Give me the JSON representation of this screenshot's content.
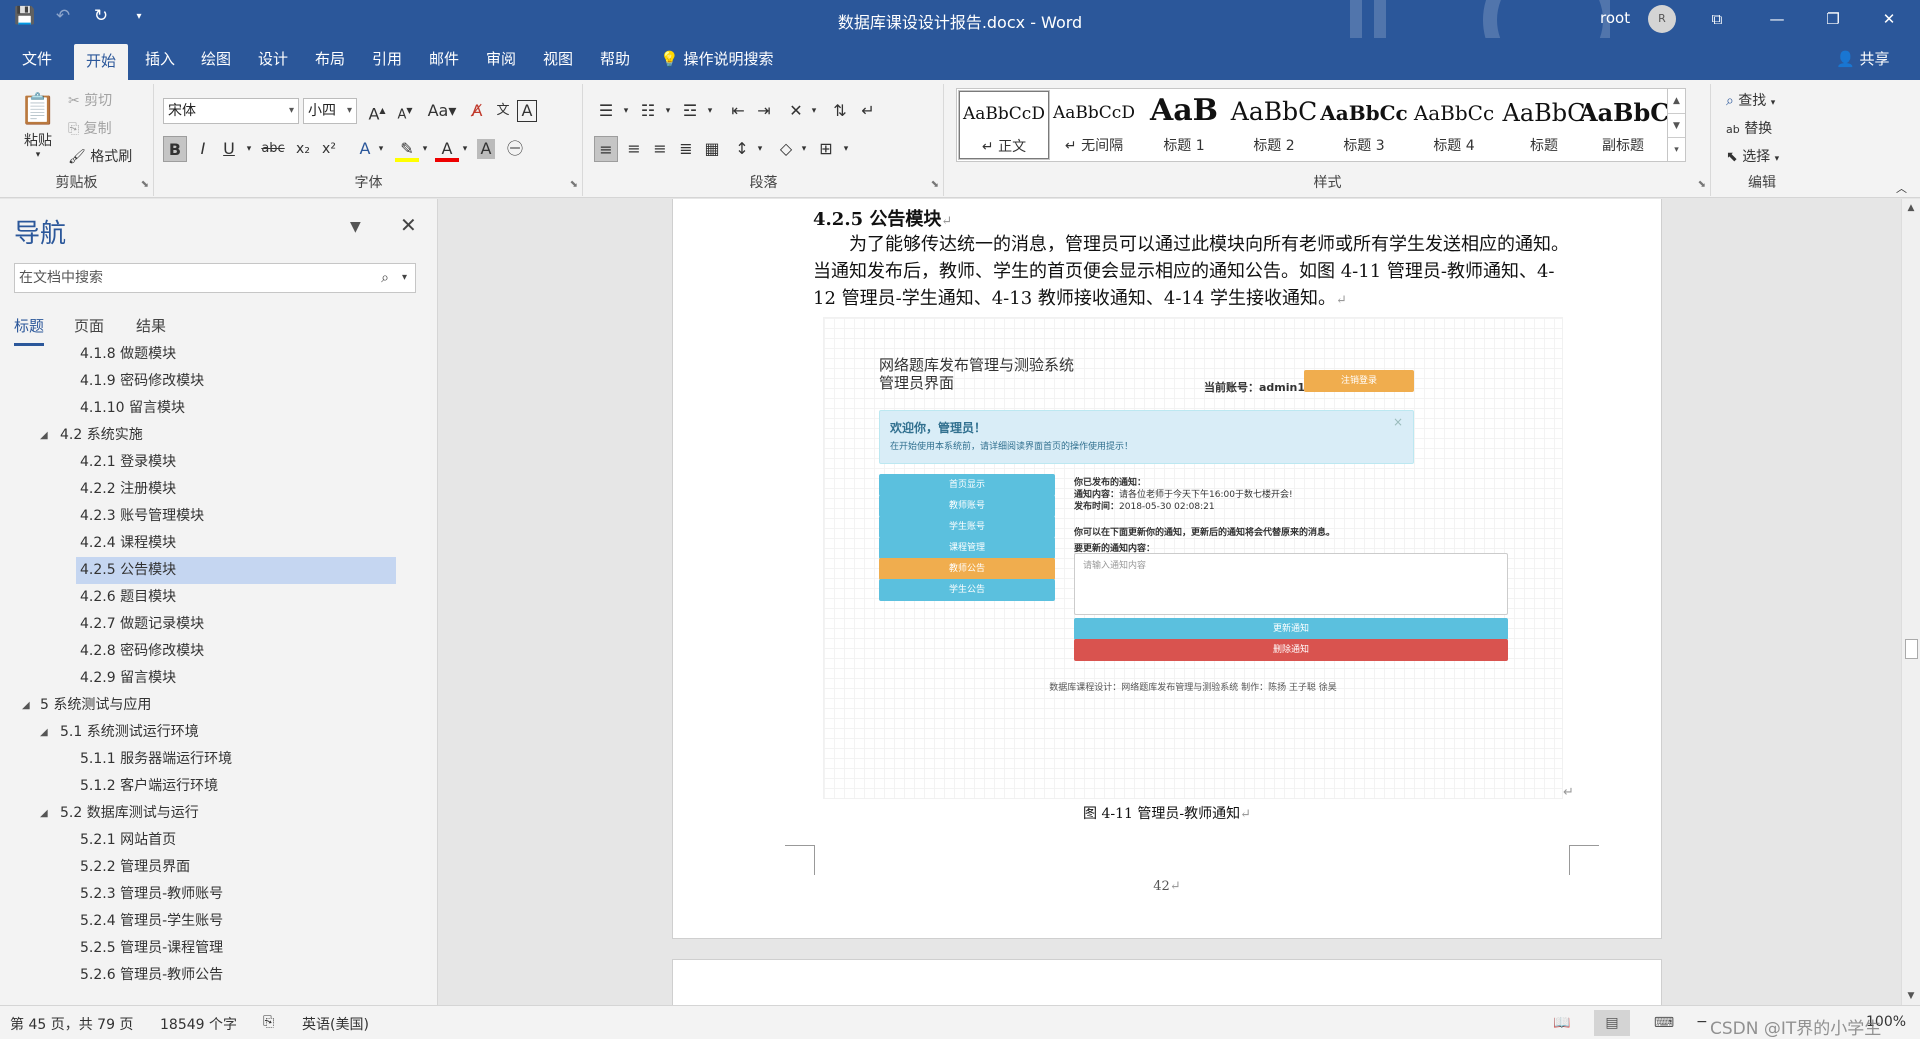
{
  "window": {
    "title": "数据库课设设计报告.docx - Word",
    "user": "root",
    "avatar_initial": "R"
  },
  "quick_access": [
    "save-icon",
    "undo-icon",
    "redo-icon",
    "customize-icon"
  ],
  "tabs": [
    {
      "label": "文件"
    },
    {
      "label": "开始"
    },
    {
      "label": "插入"
    },
    {
      "label": "绘图"
    },
    {
      "label": "设计"
    },
    {
      "label": "布局"
    },
    {
      "label": "引用"
    },
    {
      "label": "邮件"
    },
    {
      "label": "审阅"
    },
    {
      "label": "视图"
    },
    {
      "label": "帮助"
    }
  ],
  "tell_me": "操作说明搜索",
  "share": "共享",
  "clipboard": {
    "paste": "粘贴",
    "cut": "剪切",
    "copy": "复制",
    "format_painter": "格式刷",
    "label": "剪贴板"
  },
  "font": {
    "name": "宋体",
    "size": "小四",
    "label": "字体"
  },
  "paragraph": {
    "label": "段落"
  },
  "styles": {
    "label": "样式",
    "items": [
      {
        "preview": "AaBbCcD",
        "name": "↵ 正文"
      },
      {
        "preview": "AaBbCcD",
        "name": "↵ 无间隔"
      },
      {
        "preview": "AaB",
        "name": "标题 1"
      },
      {
        "preview": "AaBbC",
        "name": "标题 2"
      },
      {
        "preview": "AaBbCc",
        "name": "标题 3"
      },
      {
        "preview": "AaBbCc",
        "name": "标题 4"
      },
      {
        "preview": "AaBbC",
        "name": "标题"
      },
      {
        "preview": "AaBbC",
        "name": "副标题"
      }
    ]
  },
  "editing": {
    "find": "查找",
    "replace": "替换",
    "select": "选择",
    "label": "编辑"
  },
  "nav": {
    "title": "导航",
    "search_placeholder": "在文档中搜索",
    "tabs": [
      "标题",
      "页面",
      "结果"
    ],
    "items": [
      {
        "label": "4.1.8 做题模块",
        "level": 3
      },
      {
        "label": "4.1.9 密码修改模块",
        "level": 3
      },
      {
        "label": "4.1.10 留言模块",
        "level": 3
      },
      {
        "label": "4.2 系统实施",
        "level": 2
      },
      {
        "label": "4.2.1 登录模块",
        "level": 3
      },
      {
        "label": "4.2.2 注册模块",
        "level": 3
      },
      {
        "label": "4.2.3 账号管理模块",
        "level": 3
      },
      {
        "label": "4.2.4 课程模块",
        "level": 3
      },
      {
        "label": "4.2.5 公告模块",
        "level": 3,
        "selected": true
      },
      {
        "label": "4.2.6 题目模块",
        "level": 3
      },
      {
        "label": "4.2.7 做题记录模块",
        "level": 3
      },
      {
        "label": "4.2.8 密码修改模块",
        "level": 3
      },
      {
        "label": "4.2.9 留言模块",
        "level": 3
      },
      {
        "label": "5 系统测试与应用",
        "level": 1
      },
      {
        "label": "5.1 系统测试运行环境",
        "level": 2
      },
      {
        "label": "5.1.1 服务器端运行环境",
        "level": 3
      },
      {
        "label": "5.1.2 客户端运行环境",
        "level": 3
      },
      {
        "label": "5.2 数据库测试与运行",
        "level": 2
      },
      {
        "label": "5.2.1 网站首页",
        "level": 3
      },
      {
        "label": "5.2.2 管理员界面",
        "level": 3
      },
      {
        "label": "5.2.3 管理员-教师账号",
        "level": 3
      },
      {
        "label": "5.2.4 管理员-学生账号",
        "level": 3
      },
      {
        "label": "5.2.5 管理员-课程管理",
        "level": 3
      },
      {
        "label": "5.2.6 管理员-教师公告",
        "level": 3
      }
    ]
  },
  "document": {
    "heading": "4.2.5 公告模块",
    "paragraph": "为了能够传达统一的消息，管理员可以通过此模块向所有老师或所有学生发送相应的通知。当通知发布后，教师、学生的首页便会显示相应的通知公告。如图 4-11 管理员-教师通知、4-12 管理员-学生通知、4-13 教师接收通知、4-14 学生接收通知。",
    "caption": "图 4-11 管理员-教师通知",
    "page_number": "42"
  },
  "screenshot": {
    "app_title_1": "网络题库发布管理与测验系统",
    "app_title_2": "管理员界面",
    "account": "当前账号：admin1",
    "logout": "注销登录",
    "welcome": "欢迎你，管理员！",
    "welcome_tip": "在开始使用本系统前，请详细阅读界面首页的操作使用提示！",
    "menu": [
      "首页显示",
      "教师账号",
      "学生账号",
      "课程管理",
      "教师公告",
      "学生公告"
    ],
    "published_label": "你已发布的通知：",
    "notice_label": "通知内容：",
    "notice_value": "请各位老师于今天下午16:00于数七楼开会!",
    "time_label": "发布时间：",
    "time_value": "2018-05-30 02:08:21",
    "update_hint": "你可以在下面更新你的通知，更新后的通知将会代替原来的消息。",
    "update_label": "要更新的通知内容：",
    "textarea_placeholder": "请输入通知内容",
    "update_button": "更新通知",
    "delete_button": "删除通知",
    "footer": "数据库课程设计：网络题库发布管理与测验系统 制作：陈扬 王子聪 徐昊"
  },
  "status": {
    "page": "第 45 页，共 79 页",
    "words": "18549 个字",
    "language": "英语(美国)",
    "zoom": "100%",
    "watermark": "CSDN @IT界的小学生"
  },
  "colors": {
    "word_blue": "#2b579a",
    "info_button": "#5bc0de",
    "warning_button": "#f0ad4e",
    "danger_button": "#d9534f"
  }
}
